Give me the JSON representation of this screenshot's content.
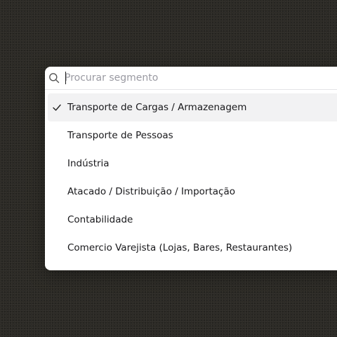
{
  "search": {
    "placeholder": "Procurar segmento",
    "value": "",
    "icon": "search-icon"
  },
  "options": [
    {
      "label": "Transporte de Cargas / Armazenagem",
      "selected": true
    },
    {
      "label": "Transporte de Pessoas",
      "selected": false
    },
    {
      "label": "Indústria",
      "selected": false
    },
    {
      "label": "Atacado / Distribuição / Importação",
      "selected": false
    },
    {
      "label": "Contabilidade",
      "selected": false
    },
    {
      "label": "Comercio Varejista (Lojas, Bares, Restaurantes)",
      "selected": false
    }
  ],
  "colors": {
    "background": "#2b2924",
    "popover": "#ffffff",
    "selected_row": "#f2f2f3",
    "text": "#18181b",
    "placeholder": "#9a9aa2"
  }
}
